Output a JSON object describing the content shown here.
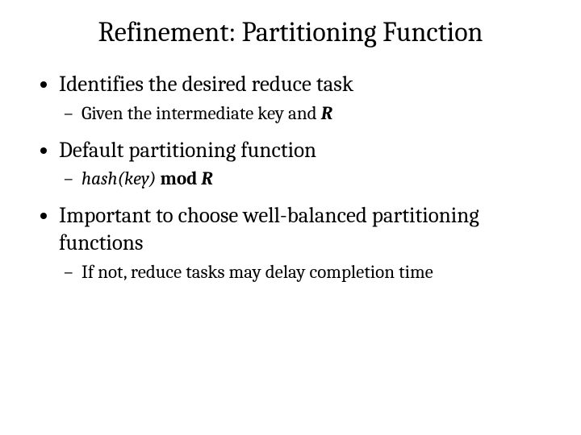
{
  "title": "Refinement: Partitioning Function",
  "b1": "Identifies the desired reduce task",
  "b1s1a": "Given the intermediate key and ",
  "b1s1b": "R",
  "b2": "Default partitioning function",
  "b2s1a": "hash(key) ",
  "b2s1b": "mod ",
  "b2s1c": "R",
  "b3": "Important to choose well-balanced partitioning functions",
  "b3s1": "If not, reduce tasks may delay completion time"
}
